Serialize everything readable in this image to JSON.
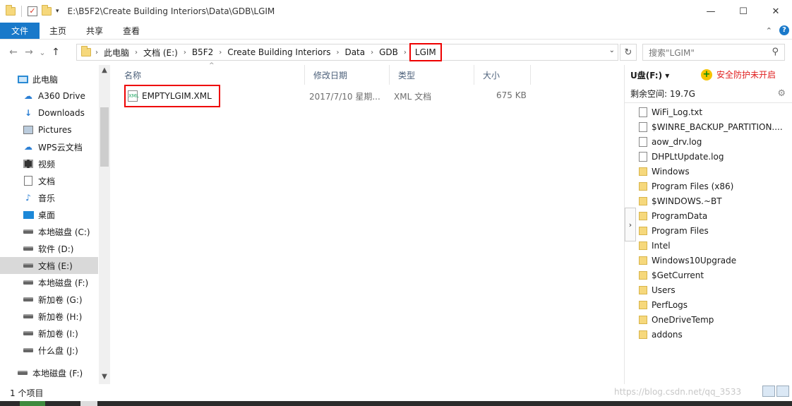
{
  "titlebar": {
    "path": "E:\\B5F2\\Create Building Interiors\\Data\\GDB\\LGIM",
    "minimize": "—",
    "maximize": "☐",
    "close": "✕",
    "qa_dropdown": "▾"
  },
  "ribbon": {
    "tabs": [
      "文件",
      "主页",
      "共享",
      "查看"
    ],
    "expand_icon": "⌃",
    "help_icon": "?"
  },
  "address": {
    "back": "←",
    "forward": "→",
    "recent": "⌄",
    "up": "↑",
    "crumbs": [
      "此电脑",
      "文档 (E:)",
      "B5F2",
      "Create Building Interiors",
      "Data",
      "GDB"
    ],
    "current": "LGIM",
    "dropdown": "⌄",
    "refresh": "↻",
    "search_placeholder": "搜索\"LGIM\"",
    "search_icon": "⚲"
  },
  "nav": {
    "items": [
      {
        "label": "此电脑",
        "icon": "pc-icon"
      },
      {
        "label": "A360 Drive",
        "icon": "cloud-drive-icon"
      },
      {
        "label": "Downloads",
        "icon": "download-icon"
      },
      {
        "label": "Pictures",
        "icon": "pictures-icon"
      },
      {
        "label": "WPS云文档",
        "icon": "cloud-icon"
      },
      {
        "label": "视频",
        "icon": "video-icon"
      },
      {
        "label": "文档",
        "icon": "document-icon"
      },
      {
        "label": "音乐",
        "icon": "music-icon"
      },
      {
        "label": "桌面",
        "icon": "desktop-icon"
      },
      {
        "label": "本地磁盘 (C:)",
        "icon": "drive-icon"
      },
      {
        "label": "软件 (D:)",
        "icon": "drive-icon"
      },
      {
        "label": "文档 (E:)",
        "icon": "drive-icon",
        "selected": true
      },
      {
        "label": "本地磁盘 (F:)",
        "icon": "drive-icon"
      },
      {
        "label": "新加卷 (G:)",
        "icon": "drive-icon"
      },
      {
        "label": "新加卷 (H:)",
        "icon": "drive-icon"
      },
      {
        "label": "新加卷 (I:)",
        "icon": "drive-icon"
      },
      {
        "label": "什么盘 (J:)",
        "icon": "drive-icon"
      },
      {
        "label": "本地磁盘 (F:)",
        "icon": "drive-icon"
      }
    ]
  },
  "filelist": {
    "columns": [
      "名称",
      "修改日期",
      "类型",
      "大小"
    ],
    "sort_indicator": "^",
    "files": [
      {
        "name": "EMPTYLGIM.XML",
        "date": "2017/7/10 星期...",
        "type": "XML 文档",
        "size": "675 KB"
      }
    ]
  },
  "preview": {
    "drive": "U盘(F:) ▾",
    "safety": "安全防护未开启",
    "free_space": "剩余空间: 19.7G",
    "toggle": "›",
    "items": [
      {
        "name": "WiFi_Log.txt",
        "kind": "file"
      },
      {
        "name": "$WINRE_BACKUP_PARTITION....",
        "kind": "file"
      },
      {
        "name": "aow_drv.log",
        "kind": "file"
      },
      {
        "name": "DHPLtUpdate.log",
        "kind": "file"
      },
      {
        "name": "Windows",
        "kind": "folder"
      },
      {
        "name": "Program Files (x86)",
        "kind": "folder"
      },
      {
        "name": "$WINDOWS.~BT",
        "kind": "folder"
      },
      {
        "name": "ProgramData",
        "kind": "folder"
      },
      {
        "name": "Program Files",
        "kind": "folder"
      },
      {
        "name": "Intel",
        "kind": "folder"
      },
      {
        "name": "Windows10Upgrade",
        "kind": "folder"
      },
      {
        "name": "$GetCurrent",
        "kind": "folder"
      },
      {
        "name": "Users",
        "kind": "folder"
      },
      {
        "name": "PerfLogs",
        "kind": "folder"
      },
      {
        "name": "OneDriveTemp",
        "kind": "folder"
      },
      {
        "name": "addons",
        "kind": "folder"
      }
    ]
  },
  "status": {
    "count": "1 个项目",
    "watermark": "https://blog.csdn.net/qq_3533"
  }
}
